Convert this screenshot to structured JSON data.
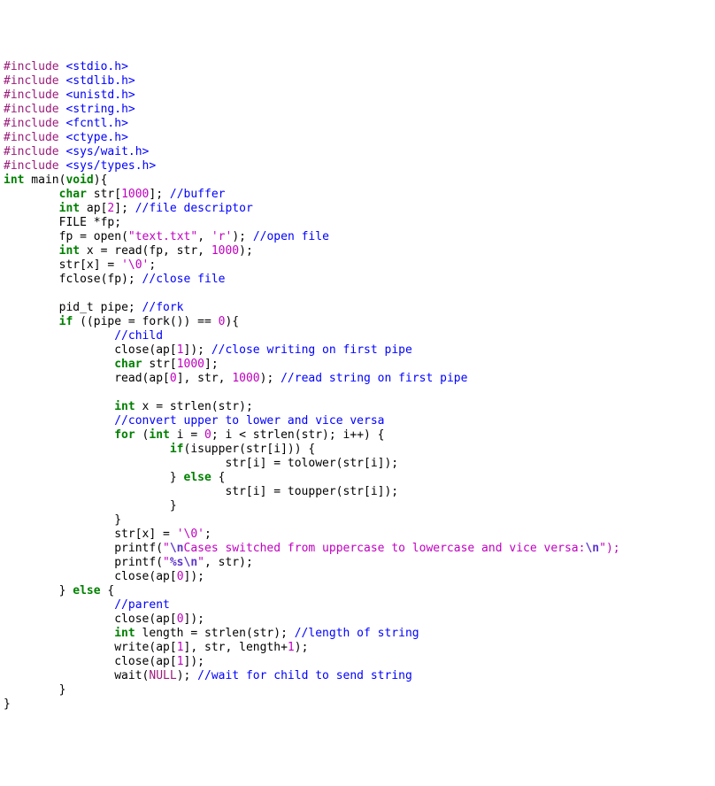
{
  "code": {
    "inc": "#include",
    "h_stdio": "<stdio.h>",
    "h_stdlib": "<stdlib.h>",
    "h_unistd": "<unistd.h>",
    "h_string": "<string.h>",
    "h_fcntl": "<fcntl.h>",
    "h_ctype": "<ctype.h>",
    "h_wait": "<sys/wait.h>",
    "h_types": "<sys/types.h>",
    "kw_int": "int",
    "kw_char": "char",
    "kw_void": "void",
    "kw_if": "if",
    "kw_else": "else",
    "kw_for": "for",
    "main_decl_a": " main(",
    "main_decl_b": "){",
    "buf_a": " str[",
    "buf_b": "]; ",
    "n1000": "1000",
    "cm_buffer": "//buffer",
    "ap_a": " ap[",
    "n2": "2",
    "ap_b": "]; ",
    "cm_fd": "//file descriptor",
    "file_decl": "FILE *fp;",
    "fp_open_a": "fp = open(",
    "s_text": "\"text.txt\"",
    "comma_sp": ", ",
    "s_r": "'r'",
    "paren_semi_sp": "); ",
    "cm_open": "//open file",
    "x_decl": " x = read(fp, str, ",
    "paren_semi": ");",
    "strx_a": "str[x] = ",
    "s_null": "'\\0'",
    "semi": ";",
    "fclose": "fclose(fp); ",
    "cm_close": "//close file",
    "pid_decl": "pid_t pipe; ",
    "cm_fork": "//fork",
    "if_open": " ((pipe = fork()) == ",
    "n0": "0",
    "brace_open": "){",
    "cm_child": "//child",
    "close_ap1": "close(ap[",
    "n1": "1",
    "close_ap_b": "]); ",
    "cm_close_w": "//close writing on first pipe",
    "char_str": " str[",
    "rbracket_semi": "];",
    "read_ap0": "read(ap[",
    "read_mid": "], str, ",
    "cm_read": "//read string on first pipe",
    "x_strlen": " x = strlen(str);",
    "cm_convert": "//convert upper to lower and vice versa",
    "for_a": " (",
    "for_b": " i = ",
    "for_c": "; i < strlen(str); i++) {",
    "if_isupper": "(isupper(str[i])) {",
    "tolower_stmt": "str[i] = tolower(str[i]);",
    "else_brace": "} ",
    "brace_only": " {",
    "toupper_stmt": "str[i] = toupper(str[i]);",
    "rbrace": "}",
    "printf_a": "printf(",
    "q": "\"",
    "esc_n": "\\n",
    "s_cases_mid": "Cases switched from uppercase to lowercase and vice versa:",
    "q_paren_semi": "\");",
    "s_pct": "%s",
    "printf_b": ", str);",
    "close_ap0": "close(ap[",
    "rbr_else": "} ",
    "cm_parent": "//parent",
    "len_decl": " length = strlen(str); ",
    "cm_len": "//length of string",
    "write_a": "write(ap[",
    "write_b": "], str, length+",
    "wait_a": "wait(",
    "null": "NULL",
    "wait_b": "); ",
    "cm_wait": "//wait for child to send string",
    "ind1": "        ",
    "ind2": "                ",
    "ind3": "                        ",
    "ind4": "                                ",
    "ind5": "                                        "
  }
}
